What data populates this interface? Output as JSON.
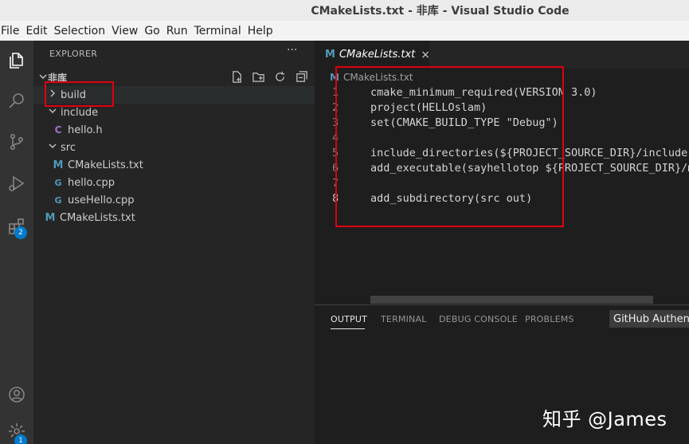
{
  "window": {
    "title": "CMakeLists.txt - 非库 - Visual Studio Code"
  },
  "menu": [
    "File",
    "Edit",
    "Selection",
    "View",
    "Go",
    "Run",
    "Terminal",
    "Help"
  ],
  "activity": {
    "extensions_badge": "2",
    "settings_badge": "1"
  },
  "explorer": {
    "header": "EXPLORER",
    "more": "···",
    "folder": "非库",
    "items": [
      {
        "label": "build",
        "kind": "folder",
        "expanded": false
      },
      {
        "label": "include",
        "kind": "folder",
        "expanded": true
      },
      {
        "label": "hello.h",
        "kind": "c",
        "icon_text": "C"
      },
      {
        "label": "src",
        "kind": "folder",
        "expanded": true
      },
      {
        "label": "CMakeLists.txt",
        "kind": "cmake",
        "icon_text": "M"
      },
      {
        "label": "hello.cpp",
        "kind": "cpp",
        "icon_text": "G"
      },
      {
        "label": "useHello.cpp",
        "kind": "cpp",
        "icon_text": "G"
      },
      {
        "label": "CMakeLists.txt",
        "kind": "cmake",
        "icon_text": "M"
      }
    ]
  },
  "editor": {
    "tab": {
      "label": "CMakeLists.txt",
      "icon_text": "M",
      "close": "×"
    },
    "breadcrumb": {
      "icon_text": "M",
      "label": "CMakeLists.txt"
    },
    "lines": [
      {
        "n": "1",
        "text": "cmake_minimum_required(VERSION 3.0)"
      },
      {
        "n": "2",
        "text": "project(HELLOslam)"
      },
      {
        "n": "3",
        "text": "set(CMAKE_BUILD_TYPE \"Debug\")"
      },
      {
        "n": "4",
        "text": ""
      },
      {
        "n": "5",
        "text": "include_directories(${PROJECT_SOURCE_DIR}/include)"
      },
      {
        "n": "6",
        "text": "add_executable(sayhellotop ${PROJECT_SOURCE_DIR}/main.cpp)"
      },
      {
        "n": "7",
        "text": ""
      },
      {
        "n": "8",
        "text": "add_subdirectory(src out)"
      }
    ]
  },
  "panel": {
    "tabs": [
      "OUTPUT",
      "TERMINAL",
      "DEBUG CONSOLE",
      "PROBLEMS"
    ],
    "output_channel": "GitHub Authentication"
  },
  "watermark": "知乎 @James",
  "colors": {
    "accent": "#007acc",
    "highlight_box": "#e0000f"
  }
}
